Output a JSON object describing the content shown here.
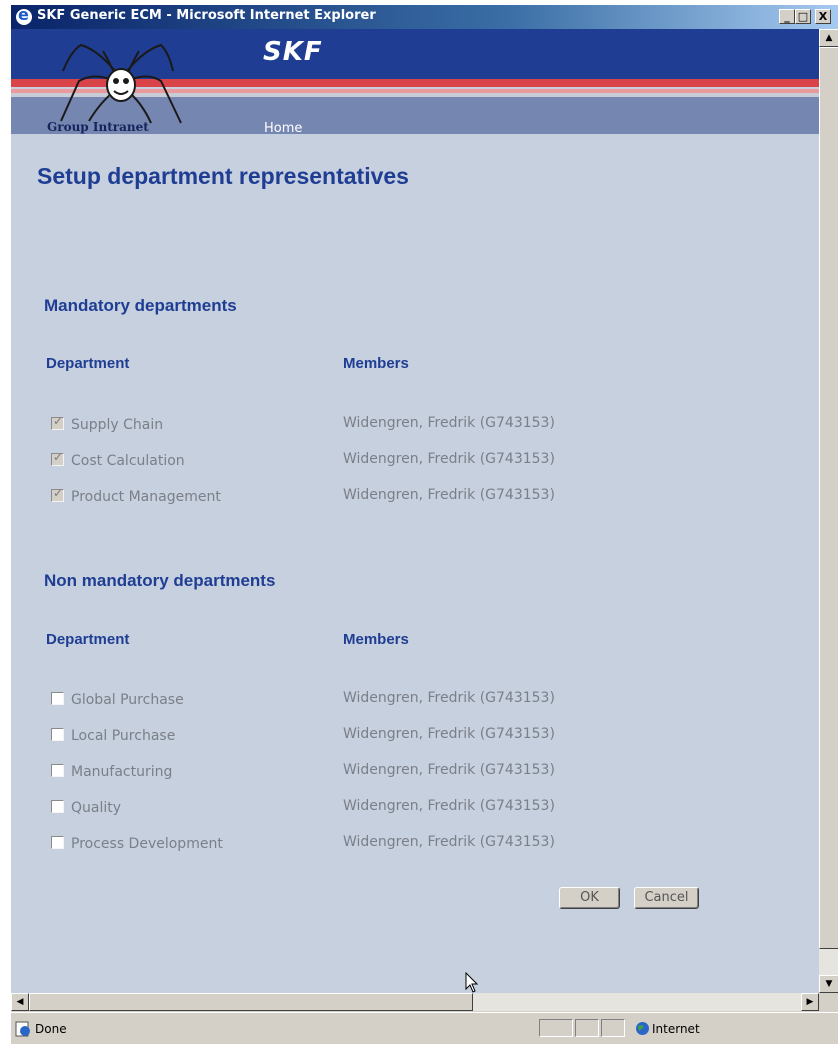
{
  "window": {
    "title": "SKF Generic ECM - Microsoft Internet Explorer",
    "controls": {
      "minimize": "_",
      "maximize": "□",
      "close": "X"
    }
  },
  "banner": {
    "brand": "SKF",
    "logo_text": "Group Intranet",
    "nav_home": "Home"
  },
  "page": {
    "title": "Setup department representatives",
    "mandatory": {
      "heading": "Mandatory departments",
      "col_department": "Department",
      "col_members": "Members",
      "rows": [
        {
          "department": "Supply Chain",
          "member": "Widengren, Fredrik (G743153)",
          "checked": true,
          "disabled": true
        },
        {
          "department": "Cost Calculation",
          "member": "Widengren, Fredrik (G743153)",
          "checked": true,
          "disabled": true
        },
        {
          "department": "Product Management",
          "member": "Widengren, Fredrik (G743153)",
          "checked": true,
          "disabled": true
        }
      ]
    },
    "non_mandatory": {
      "heading": "Non mandatory departments",
      "col_department": "Department",
      "col_members": "Members",
      "rows": [
        {
          "department": "Global Purchase",
          "member": "Widengren, Fredrik (G743153)",
          "checked": false
        },
        {
          "department": "Local Purchase",
          "member": "Widengren, Fredrik (G743153)",
          "checked": false
        },
        {
          "department": "Manufacturing",
          "member": "Widengren, Fredrik (G743153)",
          "checked": false
        },
        {
          "department": "Quality",
          "member": "Widengren, Fredrik (G743153)",
          "checked": false
        },
        {
          "department": "Process Development",
          "member": "Widengren, Fredrik (G743153)",
          "checked": false
        }
      ]
    },
    "buttons": {
      "ok": "OK",
      "cancel": "Cancel"
    }
  },
  "statusbar": {
    "status": "Done",
    "zone": "Internet"
  },
  "colors": {
    "brand_blue": "#1f3e93",
    "accent_red": "#d9434a",
    "page_bg": "#c6d0df"
  }
}
